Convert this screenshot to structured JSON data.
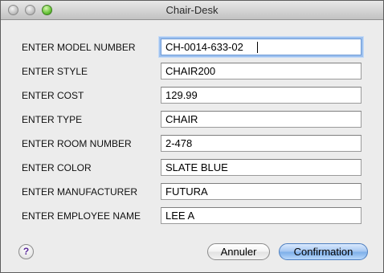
{
  "window": {
    "title": "Chair-Desk"
  },
  "form": {
    "fields": [
      {
        "label": "ENTER MODEL NUMBER",
        "value": "CH-0014-633-02"
      },
      {
        "label": "ENTER STYLE",
        "value": "CHAIR200"
      },
      {
        "label": "ENTER COST",
        "value": "129.99"
      },
      {
        "label": "ENTER TYPE",
        "value": "CHAIR"
      },
      {
        "label": "ENTER ROOM NUMBER",
        "value": "2-478"
      },
      {
        "label": "ENTER COLOR",
        "value": "SLATE BLUE"
      },
      {
        "label": "ENTER MANUFACTURER",
        "value": "FUTURA"
      },
      {
        "label": "ENTER EMPLOYEE NAME",
        "value": "LEE A"
      }
    ]
  },
  "buttons": {
    "help": "?",
    "cancel": "Annuler",
    "confirm": "Confirmation"
  },
  "icons": {
    "close": "close-icon",
    "minimize": "minimize-icon",
    "zoom": "zoom-icon",
    "help": "help-icon"
  }
}
